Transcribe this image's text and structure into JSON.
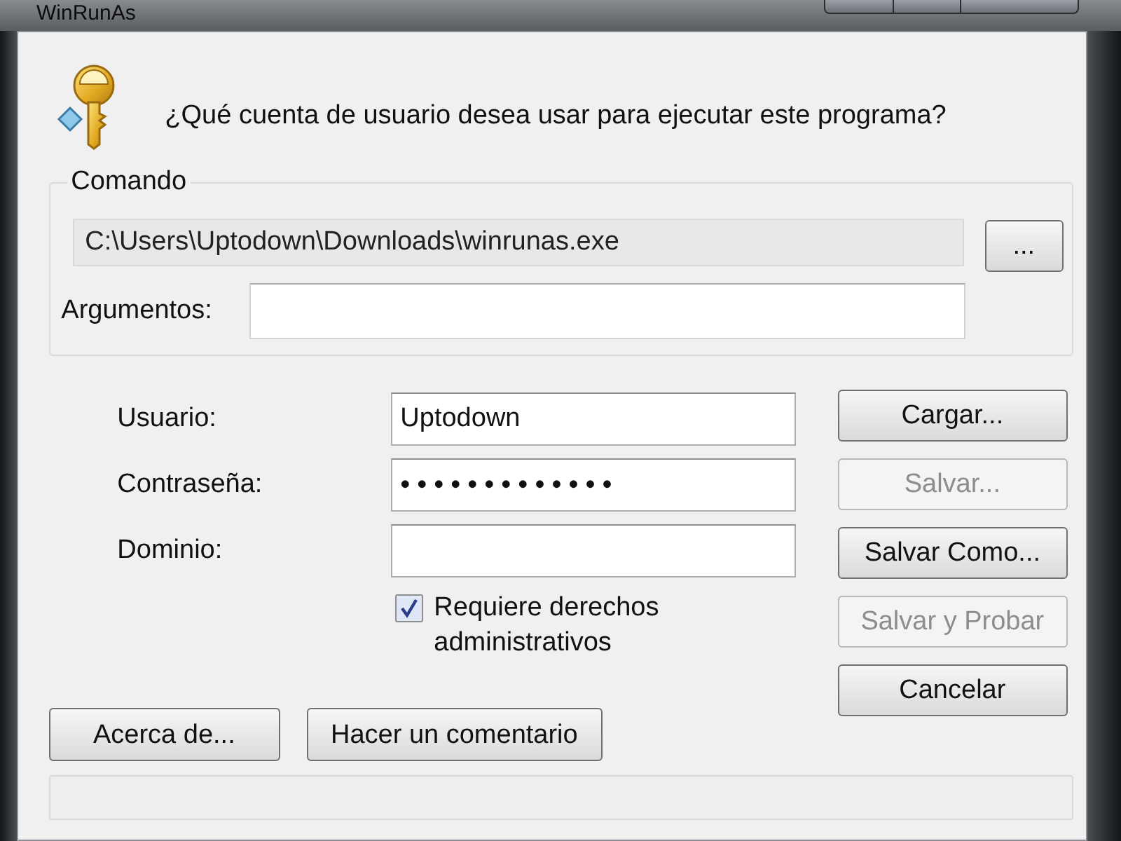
{
  "window": {
    "title": "WinRunAs"
  },
  "prompt": "¿Qué cuenta de usuario desea usar para ejecutar este programa?",
  "command_group": {
    "title": "Comando",
    "path": "C:\\Users\\Uptodown\\Downloads\\winrunas.exe",
    "browse_button": "...",
    "arguments_label": "Argumentos:"
  },
  "credentials": [
    {
      "label": "Usuario:",
      "value": "Uptodown",
      "kind": "text"
    },
    {
      "label": "Contraseña:",
      "value": "•••••••••••••",
      "kind": "password"
    },
    {
      "label": "Dominio:",
      "kind": "text"
    }
  ],
  "admin_checkbox": {
    "label": "Requiere derechos administrativos",
    "checked": true
  },
  "side_buttons": [
    {
      "label": "Cargar...",
      "disabled": false
    },
    {
      "label": "Salvar...",
      "disabled": true
    },
    {
      "label": "Salvar Como...",
      "disabled": false
    },
    {
      "label": "Salvar y Probar",
      "disabled": true
    },
    {
      "label": "Cancelar",
      "disabled": false
    }
  ],
  "bottom_buttons": [
    {
      "label": "Acerca de..."
    },
    {
      "label": "Hacer un comentario"
    }
  ]
}
